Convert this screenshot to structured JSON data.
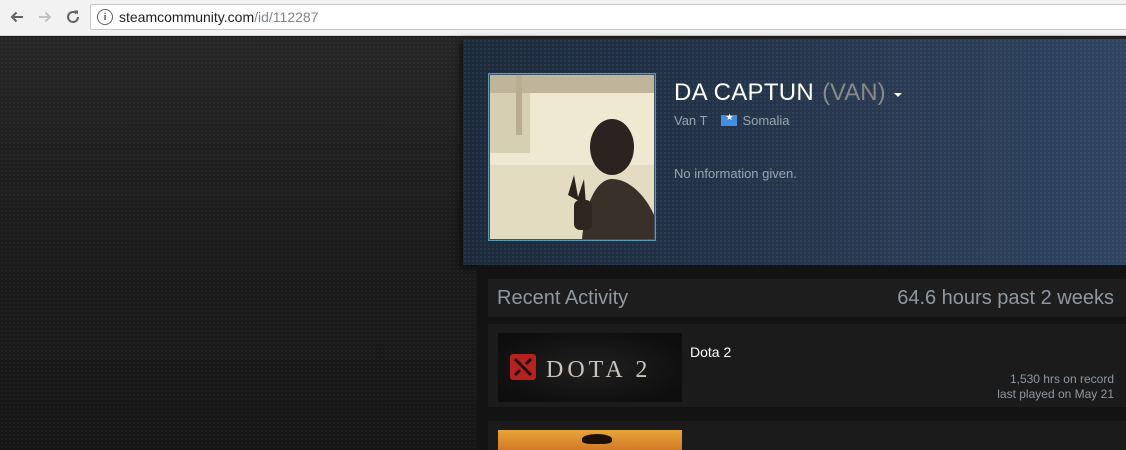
{
  "browser": {
    "back_icon": "arrow-left-icon",
    "forward_icon": "arrow-right-icon",
    "reload_icon": "reload-icon",
    "info_icon": "info-circle-icon",
    "url_host": "steamcommunity.com",
    "url_path": "/id/112287"
  },
  "profile": {
    "persona_name": "DA CAPTUN",
    "alias": "(VAN)",
    "real_name": "Van T",
    "country": "Somalia",
    "summary": "No information given."
  },
  "recent_activity": {
    "title": "Recent Activity",
    "hours_summary": "64.6 hours past 2 weeks",
    "games": [
      {
        "name": "Dota 2",
        "capsule_text": "DOTA 2",
        "hours_on_record": "1,530 hrs on record",
        "last_played": "last played on May 21"
      }
    ]
  },
  "colors": {
    "header_blue": "#223247",
    "accent_border": "#5a9ab0",
    "muted_text": "#8f98a0"
  }
}
